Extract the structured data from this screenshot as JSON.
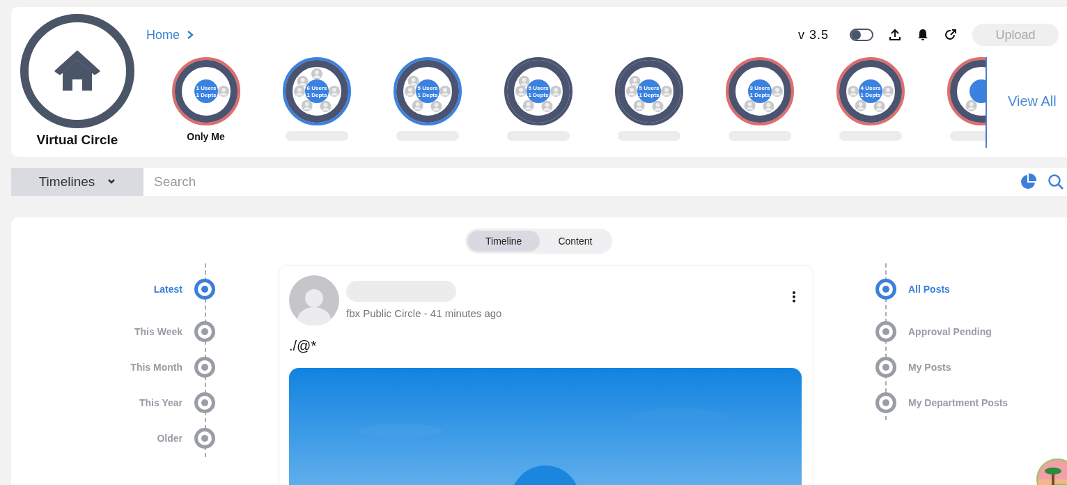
{
  "header": {
    "logo_label": "Virtual Circle",
    "breadcrumb": "Home",
    "version": "v 3.5",
    "theme_toggle": {
      "on": false
    },
    "upload_button": {
      "label": "Upload",
      "disabled": true
    }
  },
  "circles": [
    {
      "label": "Only Me",
      "users": "1 Users",
      "depts": "1 Depts",
      "color": "#e06c6c",
      "avatars": [
        {
          "kind": "avatar"
        }
      ]
    },
    {
      "users": "6 Users",
      "depts": "1 Depts",
      "color": "#3b82e0",
      "avatars": [
        {
          "kind": "avatar"
        },
        {
          "kind": "avatar"
        },
        {
          "kind": "avatar"
        },
        {
          "kind": "avatar"
        },
        {
          "kind": "avatar"
        },
        {
          "kind": "avatar"
        }
      ]
    },
    {
      "users": "5 Users",
      "depts": "1 Depts",
      "color": "#3b82e0",
      "avatars": [
        {
          "kind": "avatar"
        },
        {
          "kind": "avatar"
        },
        {
          "kind": "avatar"
        },
        {
          "kind": "avatar"
        },
        {
          "kind": "avatar"
        }
      ]
    },
    {
      "users": "5 Users",
      "depts": "1 Depts",
      "color": "#4a5470",
      "avatars": [
        {
          "kind": "avatar"
        },
        {
          "kind": "avatar"
        },
        {
          "kind": "avatar"
        },
        {
          "kind": "avatar"
        },
        {
          "kind": "avatar"
        }
      ]
    },
    {
      "users": "5 Users",
      "depts": "1 Depts",
      "color": "#4a5470",
      "avatars": [
        {
          "kind": "avatar"
        },
        {
          "kind": "avatar"
        },
        {
          "kind": "avatar"
        },
        {
          "kind": "avatar"
        },
        {
          "kind": "avatar"
        }
      ]
    },
    {
      "users": "3 Users",
      "depts": "1 Depts",
      "color": "#e06c6c",
      "avatars": [
        {
          "kind": "avatar"
        },
        {
          "kind": "avatar"
        },
        {
          "kind": "avatar"
        }
      ]
    },
    {
      "users": "4 Users",
      "depts": "1 Depts",
      "color": "#e06c6c",
      "avatars": [
        {
          "kind": "avatar"
        },
        {
          "kind": "avatar"
        },
        {
          "kind": "avatar"
        },
        {
          "kind": "avatar"
        }
      ]
    },
    {
      "color": "#e06c6c",
      "avatars": [
        {
          "kind": "hidden"
        },
        {
          "kind": "avatar"
        }
      ]
    }
  ],
  "view_all": "View All",
  "search_bar": {
    "dropdown": "Timelines",
    "placeholder": "Search"
  },
  "view_tabs": [
    {
      "label": "Timeline",
      "selected": true
    },
    {
      "label": "Content",
      "selected": false
    }
  ],
  "timeline": [
    {
      "label": "Latest",
      "selected": true
    },
    {
      "label": "This Week",
      "selected": false
    },
    {
      "label": "This Month",
      "selected": false
    },
    {
      "label": "This Year",
      "selected": false
    },
    {
      "label": "Older",
      "selected": false
    }
  ],
  "post": {
    "meta": "fbx Public Circle - 41 minutes ago",
    "text": "./@*"
  },
  "filters": [
    {
      "label": "All Posts",
      "selected": true
    },
    {
      "label": "Approval Pending",
      "selected": false
    },
    {
      "label": "My Posts",
      "selected": false
    },
    {
      "label": "My Department Posts",
      "selected": false
    }
  ]
}
